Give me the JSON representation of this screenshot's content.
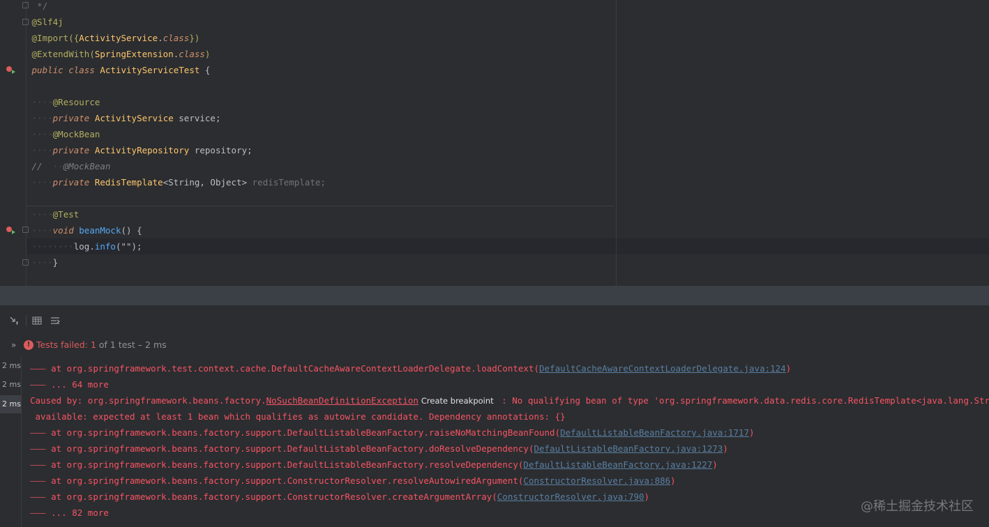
{
  "editor": {
    "lines": {
      "l0": "*/",
      "l1": "@Slf4j",
      "l2_a": "@Import({",
      "l2_b": "ActivityService",
      "l2_c": ".",
      "l2_d": "class",
      "l2_e": "})",
      "l3_a": "@ExtendWith(",
      "l3_b": "SpringExtension",
      "l3_c": ".",
      "l3_d": "class",
      "l3_e": ")",
      "l4_a": "public",
      "l4_b": "class",
      "l4_c": "ActivityServiceTest",
      "l4_d": "{",
      "l6": "@Resource",
      "l7_a": "private",
      "l7_b": "ActivityService",
      "l7_c": "service;",
      "l8": "@MockBean",
      "l9_a": "private",
      "l9_b": "ActivityRepository",
      "l9_c": "repository;",
      "l10_a": "//",
      "l10_b": "@MockBean",
      "l11_a": "private",
      "l11_b": "RedisTemplate",
      "l11_c": "<String, Object>",
      "l11_d": "redisTemplate",
      "l11_e": ";",
      "l13": "@Test",
      "l14_a": "void",
      "l14_b": "beanMock",
      "l14_c": "() {",
      "l15_a": "log",
      "l15_b": ".",
      "l15_c": "info",
      "l15_d": "(\"\");",
      "l16": "}"
    }
  },
  "status": {
    "label": "Tests failed:",
    "count": "1",
    "tail": "of 1 test – 2 ms"
  },
  "tests": [
    "2 ms",
    "2 ms",
    "2 ms"
  ],
  "console": {
    "line0_text": "at org.springframework.test.context.cache.DefaultCacheAwareContextLoaderDelegate.loadContext(",
    "line0_link": "DefaultCacheAwareContextLoaderDelegate.java:124",
    "line1_text": "... 64 more",
    "caused_prefix": "Caused by: org.springframework.beans.factory.",
    "caused_link": "NoSuchBeanDefinitionException",
    "caused_tooltip": "Create breakpoint",
    "caused_suffix": " : No qualifying bean of type 'org.springframework.data.redis.core.RedisTemplate<java.lang.String, java.lang.Object>' available",
    "caused_cont": " available: expected at least 1 bean which qualifies as autowire candidate. Dependency annotations: {}",
    "frames": [
      {
        "text": "at org.springframework.beans.factory.support.DefaultListableBeanFactory.raiseNoMatchingBeanFound(",
        "link": "DefaultListableBeanFactory.java:1717"
      },
      {
        "text": "at org.springframework.beans.factory.support.DefaultListableBeanFactory.doResolveDependency(",
        "link": "DefaultListableBeanFactory.java:1273"
      },
      {
        "text": "at org.springframework.beans.factory.support.DefaultListableBeanFactory.resolveDependency(",
        "link": "DefaultListableBeanFactory.java:1227"
      },
      {
        "text": "at org.springframework.beans.factory.support.ConstructorResolver.resolveAutowiredArgument(",
        "link": "ConstructorResolver.java:886"
      },
      {
        "text": "at org.springframework.beans.factory.support.ConstructorResolver.createArgumentArray(",
        "link": "ConstructorResolver.java:790"
      }
    ],
    "last_text": "... 82 more"
  },
  "watermark": "@稀土掘金技术社区"
}
